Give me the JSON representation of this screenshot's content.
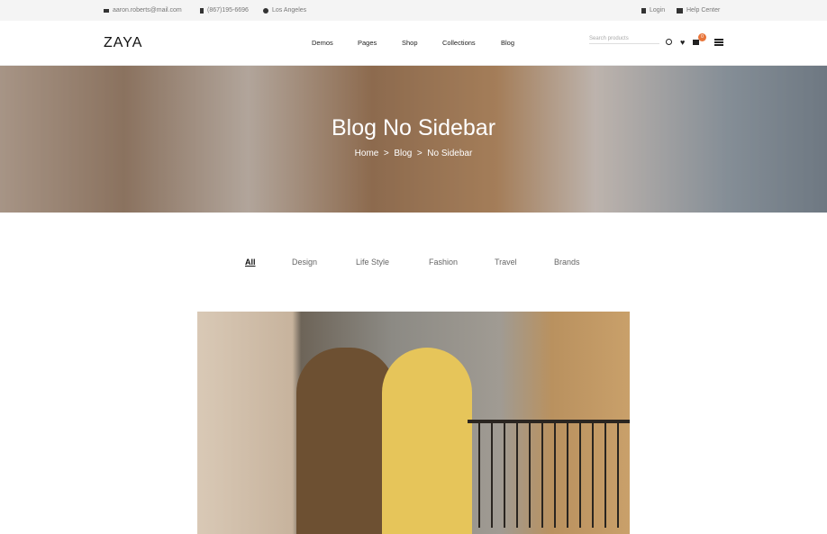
{
  "topbar": {
    "email": "aaron.roberts@mail.com",
    "phone": "(867)195-6696",
    "location": "Los Angeles",
    "login": "Login",
    "help": "Help Center"
  },
  "header": {
    "logo": "ZAYA",
    "nav": [
      "Demos",
      "Pages",
      "Shop",
      "Collections",
      "Blog"
    ],
    "search_placeholder": "Search products",
    "cart_count": "0"
  },
  "hero": {
    "title": "Blog No Sidebar",
    "breadcrumb": [
      "Home",
      ">",
      "Blog",
      ">",
      "No Sidebar"
    ]
  },
  "filters": [
    "All",
    "Design",
    "Life Style",
    "Fashion",
    "Travel",
    "Brands"
  ],
  "colors": {
    "accent": "#e8753a"
  }
}
